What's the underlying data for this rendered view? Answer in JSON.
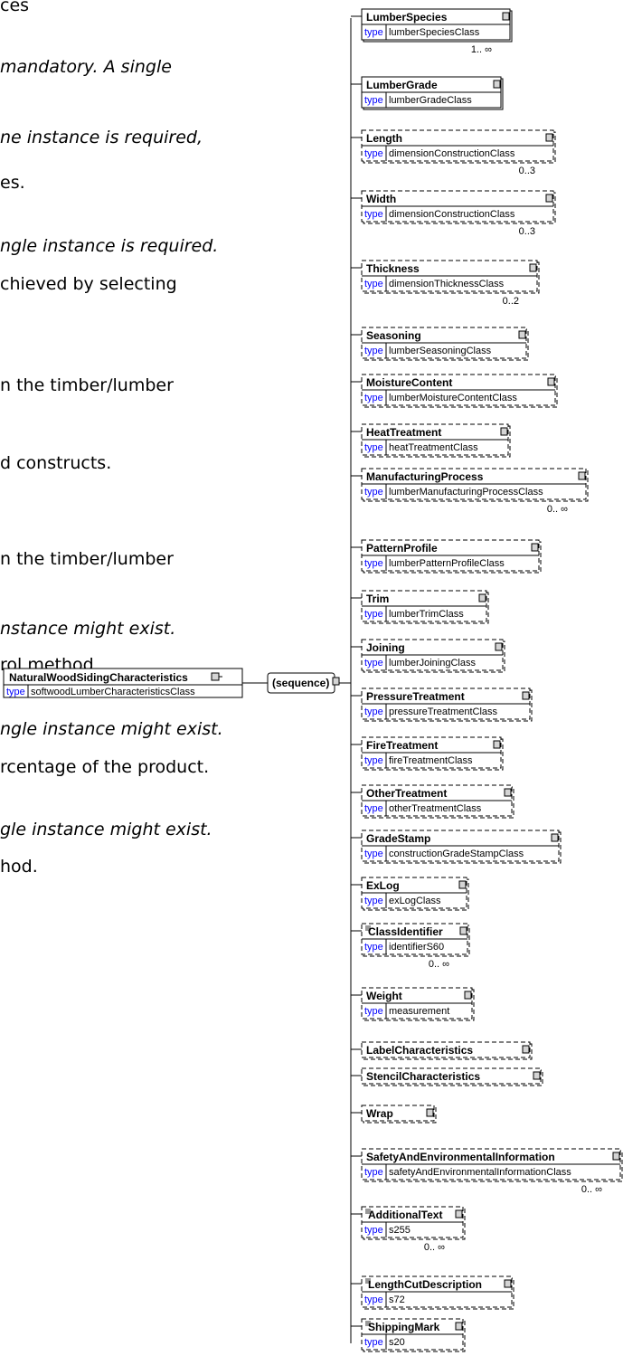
{
  "background_text": [
    {
      "text": "ces",
      "italic": false
    },
    {
      "text": "mandatory. A single",
      "italic": true
    },
    {
      "text": "ne instance is required,",
      "italic": true
    },
    {
      "text": "es.",
      "italic": false
    },
    {
      "text": "ngle instance is required.",
      "italic": true
    },
    {
      "text": "chieved by selecting",
      "italic": false
    },
    {
      "text": "n the timber/lumber",
      "italic": false
    },
    {
      "text": "d constructs.",
      "italic": false
    },
    {
      "text": "n the timber/lumber",
      "italic": false
    },
    {
      "text": "nstance might exist.",
      "italic": true
    },
    {
      "text": "rol method.",
      "italic": false
    },
    {
      "text": "ngle instance might exist.",
      "italic": true
    },
    {
      "text": "rcentage of the product.",
      "italic": false
    },
    {
      "text": "gle instance might exist.",
      "italic": true
    },
    {
      "text": "hod.",
      "italic": false
    }
  ],
  "root": {
    "name": "NaturalWoodSidingCharacteristics",
    "type_keyword": "type",
    "type": "softwoodLumberCharacteristicsClass"
  },
  "sequence_label": "(sequence)",
  "elements": [
    {
      "name": "LumberSpecies",
      "type": "lumberSpeciesClass",
      "optional": false,
      "cardinality": "1.. ∞",
      "list_icon": false
    },
    {
      "name": "LumberGrade",
      "type": "lumberGradeClass",
      "optional": false,
      "cardinality": "",
      "list_icon": false
    },
    {
      "name": "Length",
      "type": "dimensionConstructionClass",
      "optional": true,
      "cardinality": "0..3",
      "list_icon": false
    },
    {
      "name": "Width",
      "type": "dimensionConstructionClass",
      "optional": true,
      "cardinality": "0..3",
      "list_icon": false
    },
    {
      "name": "Thickness",
      "type": "dimensionThicknessClass",
      "optional": true,
      "cardinality": "0..2",
      "list_icon": false
    },
    {
      "name": "Seasoning",
      "type": "lumberSeasoningClass",
      "optional": true,
      "cardinality": "",
      "list_icon": false
    },
    {
      "name": "MoistureContent",
      "type": "lumberMoistureContentClass",
      "optional": true,
      "cardinality": "",
      "list_icon": false
    },
    {
      "name": "HeatTreatment",
      "type": "heatTreatmentClass",
      "optional": true,
      "cardinality": "",
      "list_icon": false
    },
    {
      "name": "ManufacturingProcess",
      "type": "lumberManufacturingProcessClass",
      "optional": true,
      "cardinality": "0.. ∞",
      "list_icon": false
    },
    {
      "name": "PatternProfile",
      "type": "lumberPatternProfileClass",
      "optional": true,
      "cardinality": "",
      "list_icon": false
    },
    {
      "name": "Trim",
      "type": "lumberTrimClass",
      "optional": true,
      "cardinality": "",
      "list_icon": false
    },
    {
      "name": "Joining",
      "type": "lumberJoiningClass",
      "optional": true,
      "cardinality": "",
      "list_icon": false
    },
    {
      "name": "PressureTreatment",
      "type": "pressureTreatmentClass",
      "optional": true,
      "cardinality": "",
      "list_icon": false
    },
    {
      "name": "FireTreatment",
      "type": "fireTreatmentClass",
      "optional": true,
      "cardinality": "",
      "list_icon": false
    },
    {
      "name": "OtherTreatment",
      "type": "otherTreatmentClass",
      "optional": true,
      "cardinality": "",
      "list_icon": false
    },
    {
      "name": "GradeStamp",
      "type": "constructionGradeStampClass",
      "optional": true,
      "cardinality": "",
      "list_icon": false
    },
    {
      "name": "ExLog",
      "type": "exLogClass",
      "optional": true,
      "cardinality": "",
      "list_icon": false
    },
    {
      "name": "ClassIdentifier",
      "type": "identifierS60",
      "optional": true,
      "cardinality": "0.. ∞",
      "list_icon": true
    },
    {
      "name": "Weight",
      "type": "measurement",
      "optional": true,
      "cardinality": "",
      "list_icon": false
    },
    {
      "name": "LabelCharacteristics",
      "type": "",
      "optional": true,
      "cardinality": "",
      "list_icon": false
    },
    {
      "name": "StencilCharacteristics",
      "type": "",
      "optional": true,
      "cardinality": "",
      "list_icon": false
    },
    {
      "name": "Wrap",
      "type": "",
      "optional": true,
      "cardinality": "",
      "list_icon": false
    },
    {
      "name": "SafetyAndEnvironmentalInformation",
      "type": "safetyAndEnvironmentalInformationClass",
      "optional": true,
      "cardinality": "0.. ∞",
      "list_icon": false
    },
    {
      "name": "AdditionalText",
      "type": "s255",
      "optional": true,
      "cardinality": "0.. ∞",
      "list_icon": true
    },
    {
      "name": "LengthCutDescription",
      "type": "s72",
      "optional": true,
      "cardinality": "",
      "list_icon": true
    },
    {
      "name": "ShippingMark",
      "type": "s20",
      "optional": true,
      "cardinality": "",
      "list_icon": true
    }
  ]
}
